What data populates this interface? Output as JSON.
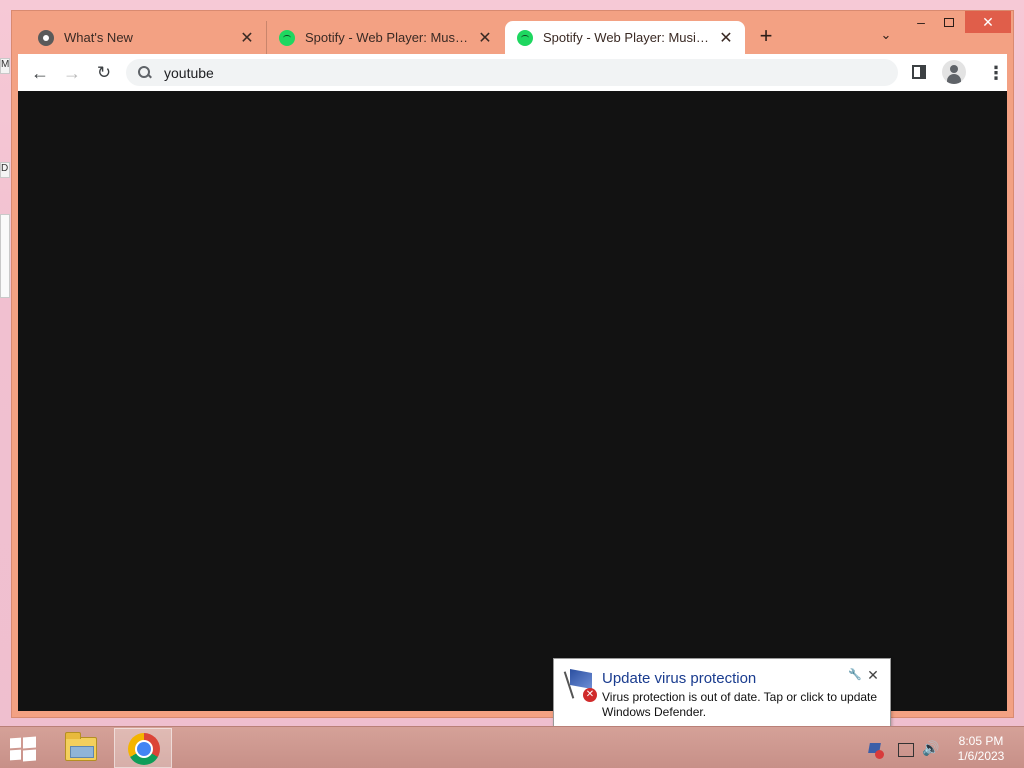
{
  "desktop": {
    "fragments": [
      "M",
      "D"
    ]
  },
  "browser": {
    "tabs": [
      {
        "title": "What's New",
        "icon": "chrome-icon",
        "active": false
      },
      {
        "title": "Spotify - Web Player: Music for everyone",
        "icon": "spotify-icon",
        "active": false
      },
      {
        "title": "Spotify - Web Player: Music for everyone",
        "icon": "spotify-icon",
        "active": true
      }
    ],
    "new_tab_label": "+",
    "window_controls": {
      "minimize": "–",
      "close": "✕"
    },
    "omnibox": {
      "value": "youtube"
    },
    "content_color": "#121212"
  },
  "notification": {
    "title": "Update virus protection",
    "body": "Virus protection is out of date. Tap or click to update Windows Defender.",
    "error_glyph": "✕",
    "close_glyph": "✕",
    "settings_glyph": "🔧"
  },
  "taskbar": {
    "pinned": [
      "file-explorer-icon",
      "chrome-icon"
    ],
    "clock": {
      "time": "8:05 PM",
      "date": "1/6/2023"
    }
  },
  "colors": {
    "accent": "#f3a183",
    "close_button": "#e05e4a",
    "notification_title": "#1a3c8f"
  }
}
